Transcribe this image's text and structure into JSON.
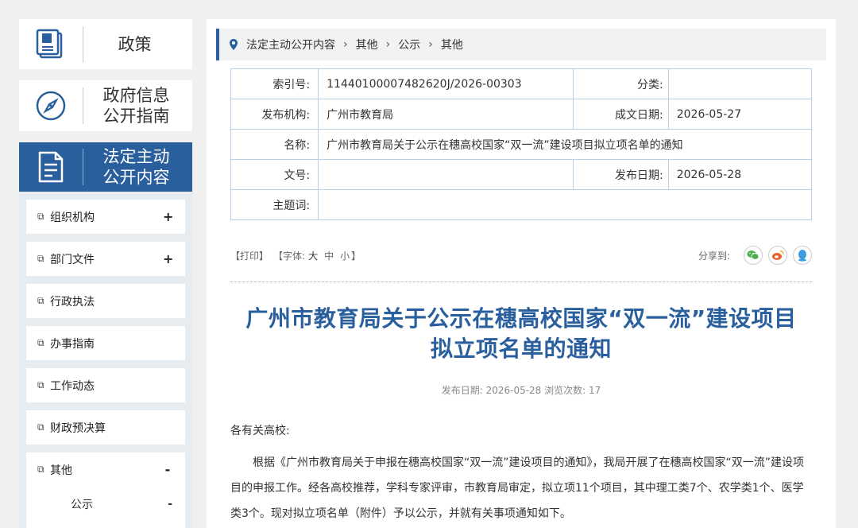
{
  "sidebar": {
    "blocks": [
      {
        "title": "政策",
        "icon": "book-icon"
      },
      {
        "title": "政府信息公开指南",
        "icon": "compass-icon"
      },
      {
        "title": "法定主动公开内容",
        "icon": "document-icon"
      }
    ],
    "menu": [
      {
        "label": "组织机构",
        "sign": "+"
      },
      {
        "label": "部门文件",
        "sign": "+"
      },
      {
        "label": "行政执法",
        "sign": ""
      },
      {
        "label": "办事指南",
        "sign": ""
      },
      {
        "label": "工作动态",
        "sign": ""
      },
      {
        "label": "财政预决算",
        "sign": ""
      },
      {
        "label": "其他",
        "sign": "-"
      }
    ],
    "submenu": [
      {
        "label": "公示",
        "sign": "-"
      }
    ]
  },
  "breadcrumb": [
    "法定主动公开内容",
    "其他",
    "公示",
    "其他"
  ],
  "meta": {
    "index_label": "索引号:",
    "index_value": "11440100007482620J/2026-00303",
    "category_label": "分类:",
    "category_value": "",
    "publisher_label": "发布机构:",
    "publisher_value": "广州市教育局",
    "written_date_label": "成文日期:",
    "written_date_value": "2026-05-27",
    "name_label": "名称:",
    "name_value": "广州市教育局关于公示在穗高校国家“双一流”建设项目拟立项名单的通知",
    "doc_no_label": "文号:",
    "doc_no_value": "",
    "publish_date_label": "发布日期:",
    "publish_date_value": "2026-05-28",
    "keywords_label": "主题词:",
    "keywords_value": ""
  },
  "toolbar": {
    "print": "【打印】",
    "font_prefix": "【字体:",
    "font_large": "大",
    "font_medium": "中",
    "font_small": "小",
    "font_suffix": "】",
    "share_label": "分享到:"
  },
  "article": {
    "title_line1": "广州市教育局关于公示在穗高校国家“双一流”建设项目",
    "title_line2": "拟立项名单的通知",
    "publish_info": "发布日期: 2026-05-28  浏览次数: 17",
    "greeting": "各有关高校:",
    "paragraph1": "根据《广州市教育局关于申报在穗高校国家“双一流”建设项目的通知》，我局开展了在穗高校国家“双一流”建设项目的申报工作。经各高校推荐，学科专家评审，市教育局审定，拟立项11个项目，其中理工类7个、农学类1个、医学类3个。现对拟立项名单（附件）予以公示，并就有关事项通知如下。"
  },
  "colors": {
    "accent": "#2a5f9e",
    "wechat": "#4caf50",
    "weibo": "#e8602c",
    "qq": "#3a9be0"
  }
}
